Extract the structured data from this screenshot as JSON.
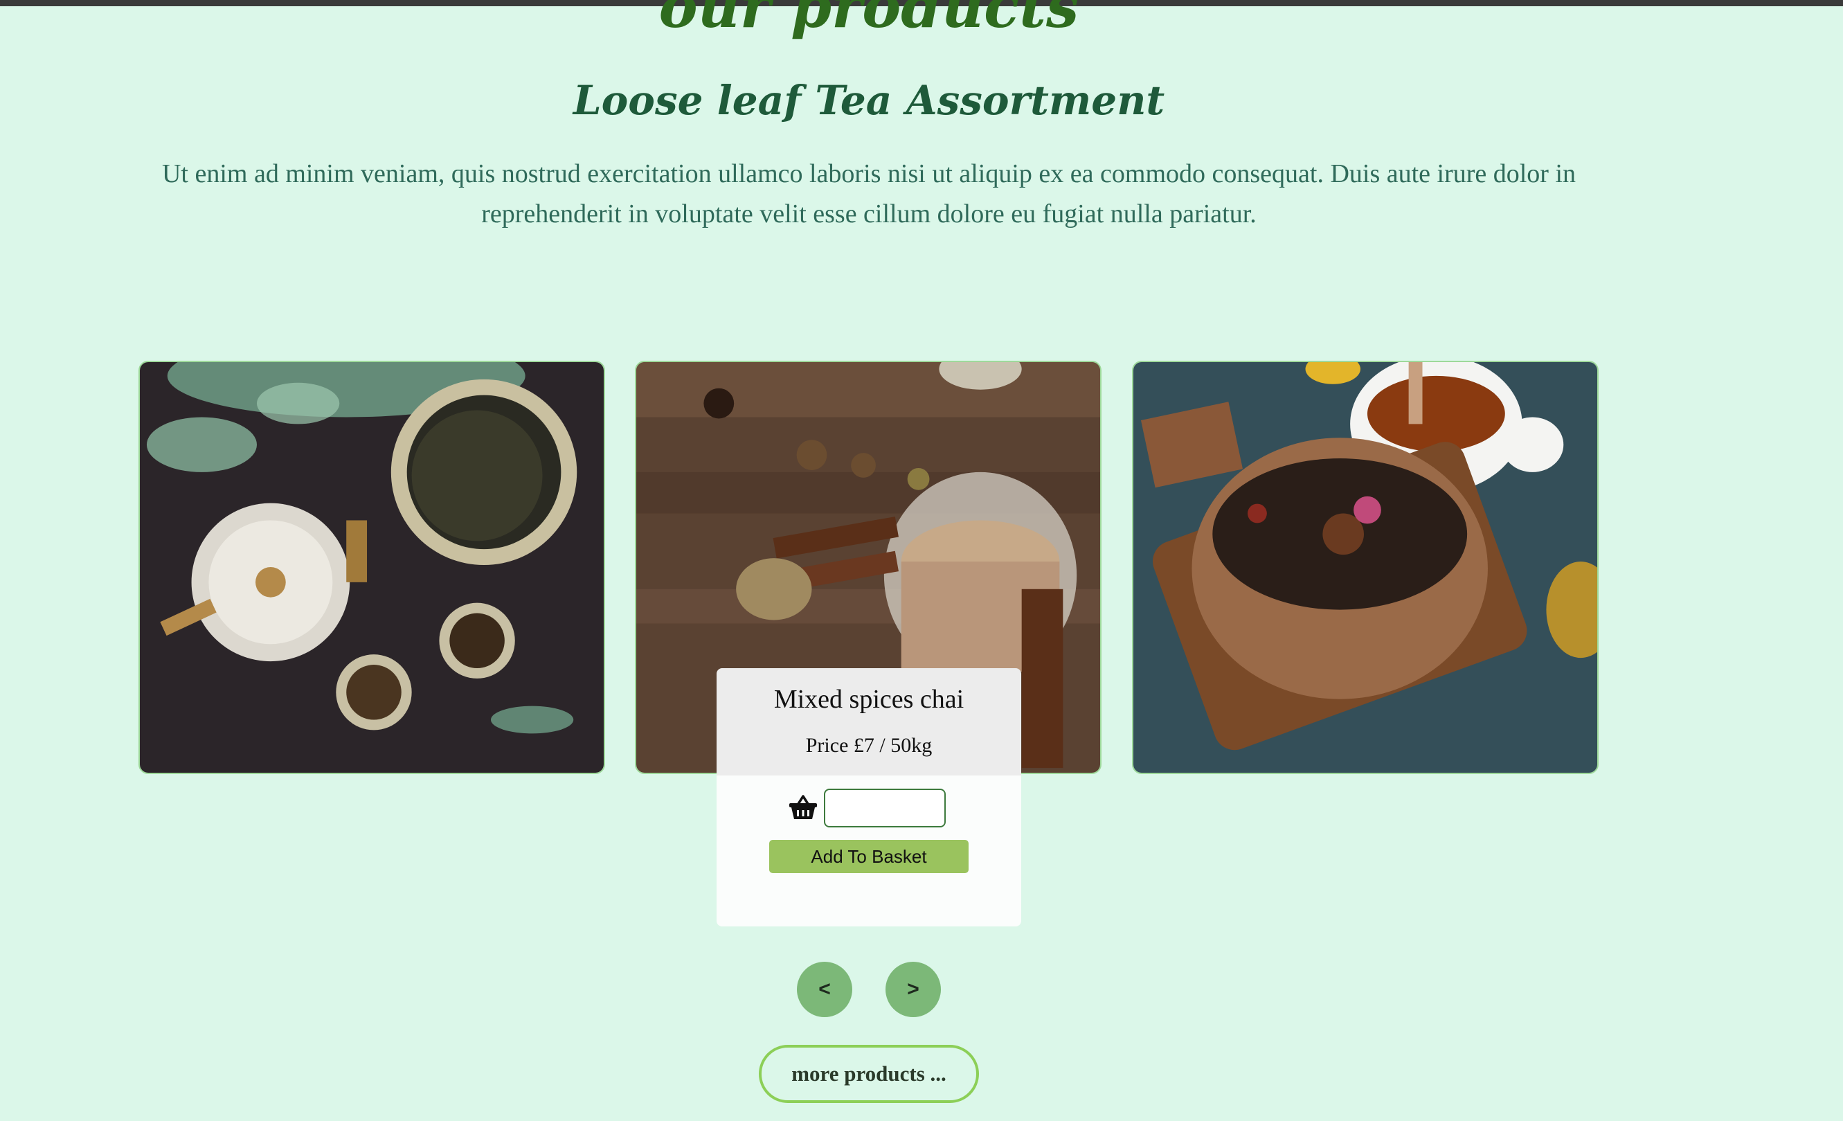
{
  "section": {
    "title": "our products",
    "subtitle": "Loose leaf Tea Assortment",
    "intro": "Ut enim ad minim veniam, quis nostrud exercitation ullamco laboris nisi ut aliquip ex ea commodo consequat. Duis aute irure dolor in reprehenderit in voluptate velit esse cillum dolore eu fugiat nulla pariatur."
  },
  "products": [
    {
      "image": "teapot-and-loose-tea-photo"
    },
    {
      "image": "masala-chai-with-spices-photo",
      "name": "Mixed spices chai",
      "price": "Price £7 / 50kg"
    },
    {
      "image": "spiced-tea-wooden-bowl-photo"
    }
  ],
  "basket": {
    "icon": "basket-icon",
    "quantity_value": "",
    "add_label": "Add To Basket"
  },
  "carousel": {
    "prev_label": "<",
    "next_label": ">"
  },
  "more_label": "more products ...",
  "colors": {
    "background": "#dbf7e9",
    "title_green": "#2e6b1e",
    "accent_green": "#9ac35e",
    "nav_green": "#7cb878",
    "card_border": "#9ed99a"
  }
}
